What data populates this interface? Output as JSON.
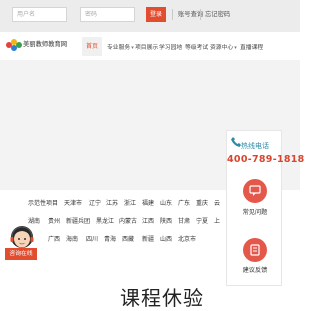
{
  "topbar": {
    "username_placeholder": "用户名",
    "password_placeholder": "密码",
    "login_label": "登录",
    "query_label": "账号查询",
    "forgot_label": "忘记密码"
  },
  "nav": {
    "logo_text": "美丽教师教育网",
    "home_label": "首页",
    "items": [
      "专业服务",
      "项目展示",
      "学习园地",
      "等级考试",
      "资源中心",
      "直播课程"
    ]
  },
  "hotline": {
    "label": "热线电话",
    "number": "400-789-1818"
  },
  "sidebar_buttons": {
    "faq_label": "常见问题",
    "feedback_label": "建议反馈"
  },
  "regions": {
    "row1": [
      "示范性项目",
      "天津市",
      "辽宁",
      "江苏",
      "浙江",
      "福建",
      "山东",
      "广东",
      "重庆",
      "云"
    ],
    "row2": [
      "湖南",
      "贵州",
      "新疆兵团",
      "黑龙江",
      "内蒙古",
      "江西",
      "陕西",
      "甘肃",
      "宁夏",
      "上"
    ],
    "row3": [
      "广西",
      "海南",
      "四川",
      "青海",
      "西藏",
      "新疆",
      "山西",
      "北京市"
    ]
  },
  "online_service_label": "咨询在线",
  "bottom_title": "课程休验",
  "colors": {
    "accent": "#e14d2e",
    "hotline_number": "#d8452f",
    "hotline_label": "#2c8ca5",
    "circle_button": "#e4584c"
  }
}
